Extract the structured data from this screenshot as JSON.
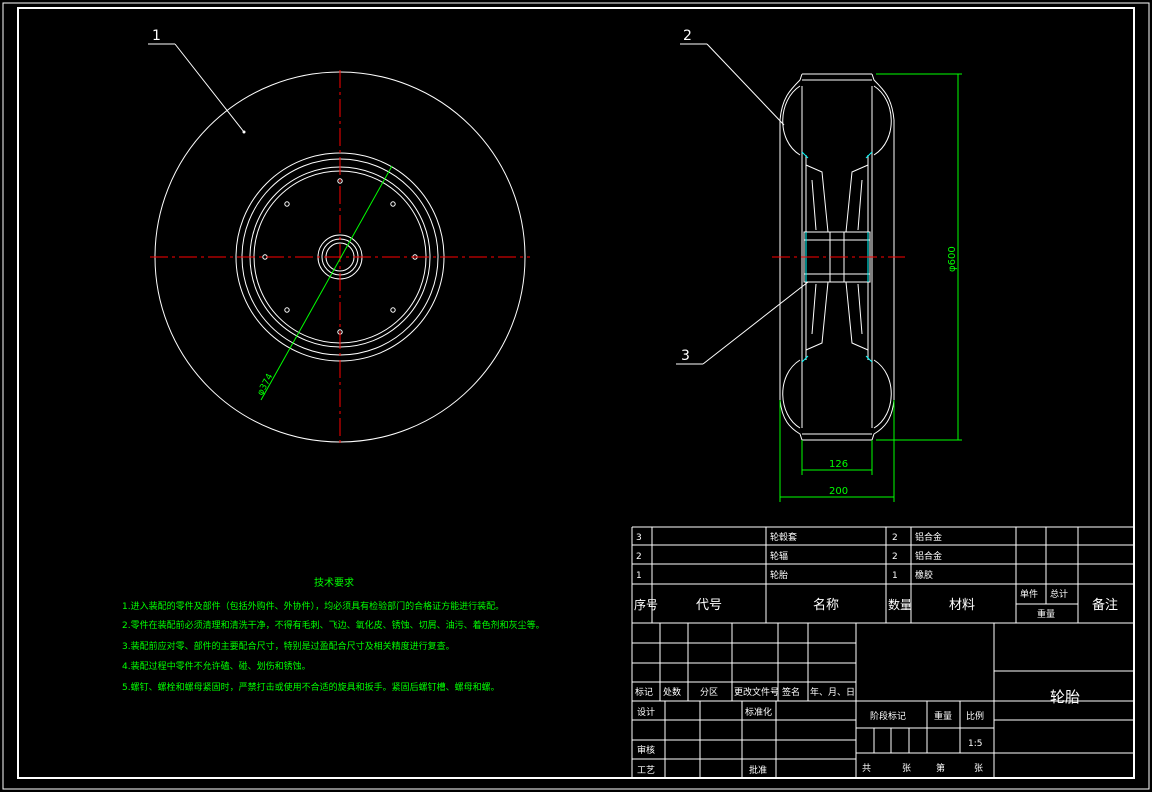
{
  "balloons": {
    "b1": "1",
    "b2": "2",
    "b3": "3"
  },
  "dimensions": {
    "dia_hub": "φ374",
    "dia_outer": "φ600",
    "width_inner": "126",
    "width_outer": "200"
  },
  "tech_requirements": {
    "title": "技术要求",
    "lines": [
      "1.进入装配的零件及部件（包括外购件、外协件），均必须具有检验部门的合格证方能进行装配。",
      "2.零件在装配前必须清理和清洗干净，不得有毛刺、飞边、氧化皮、锈蚀、切屑、油污、着色剂和灰尘等。",
      "3.装配前应对零、部件的主要配合尺寸，特别是过盈配合尺寸及相关精度进行复查。",
      "4.装配过程中零件不允许磕、碰、划伤和锈蚀。",
      "5.螺钉、螺栓和螺母紧固时，严禁打击或使用不合适的旋具和扳手。紧固后螺钉槽、螺母和螺。"
    ]
  },
  "bom": {
    "rows": [
      {
        "no": "3",
        "code": "",
        "name": "轮毂套",
        "qty": "2",
        "material": "铝合金"
      },
      {
        "no": "2",
        "code": "",
        "name": "轮辐",
        "qty": "2",
        "material": "铝合金"
      },
      {
        "no": "1",
        "code": "",
        "name": "轮胎",
        "qty": "1",
        "material": "橡胶"
      }
    ],
    "header": {
      "no": "序号",
      "code": "代号",
      "name": "名称",
      "qty": "数量",
      "material": "材料",
      "unit": "单件",
      "total": "总计",
      "weight": "重量",
      "remark": "备注"
    }
  },
  "title_block": {
    "part_name": "轮胎",
    "rev_labels": [
      "标记",
      "处数",
      "分区",
      "更改文件号",
      "签名",
      "年、月、日"
    ],
    "design": "设计",
    "standardization": "标准化",
    "check": "审核",
    "process": "工艺",
    "approve": "批准",
    "stage_mark": "阶段标记",
    "weight": "重量",
    "scale": "比例",
    "scale_value": "1:5",
    "sheets_total_label": "共",
    "sheet_unit_a": "张",
    "sheet_no_label": "第",
    "sheet_unit_b": "张"
  },
  "colors": {
    "line": "#ffffff",
    "center": "#ff0000",
    "dimension": "#00ff00",
    "hidden": "#00ffff",
    "background": "#000000"
  }
}
